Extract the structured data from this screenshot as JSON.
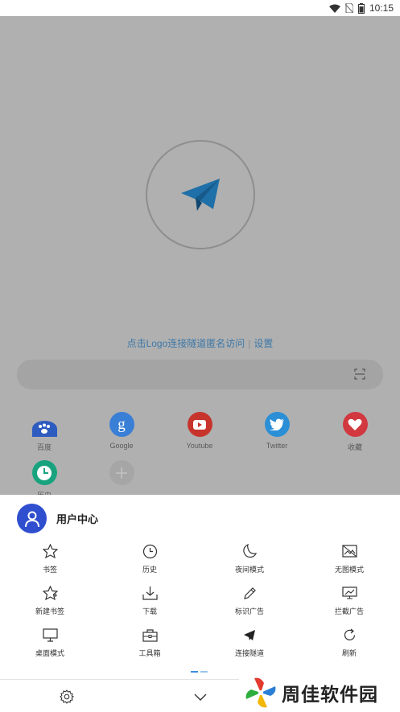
{
  "status_bar": {
    "time": "10:15"
  },
  "home": {
    "hint_text": "点击Logo连接隧道匿名访问",
    "hint_link": "设置",
    "quick_links": [
      {
        "label": "百度",
        "icon": "paw-icon",
        "color": "#2e5bbf"
      },
      {
        "label": "Google",
        "icon": "google-icon",
        "color": "#3a7fd6"
      },
      {
        "label": "Youtube",
        "icon": "youtube-icon",
        "color": "#c7342b"
      },
      {
        "label": "Twitter",
        "icon": "twitter-icon",
        "color": "#2b8fd6"
      },
      {
        "label": "收藏",
        "icon": "heart-icon",
        "color": "#d2383f"
      },
      {
        "label": "历史",
        "icon": "clock-icon",
        "color": "#18a37e"
      },
      {
        "label": "",
        "icon": "plus-icon",
        "color": "#a6a6a6"
      }
    ]
  },
  "sheet": {
    "user_center": "用户中心",
    "menu": [
      {
        "label": "书签",
        "icon": "star-icon"
      },
      {
        "label": "历史",
        "icon": "clock-icon"
      },
      {
        "label": "夜间模式",
        "icon": "moon-icon"
      },
      {
        "label": "无图模式",
        "icon": "no-image-icon"
      },
      {
        "label": "新建书签",
        "icon": "star-plus-icon"
      },
      {
        "label": "下载",
        "icon": "download-icon"
      },
      {
        "label": "标识广告",
        "icon": "pen-icon"
      },
      {
        "label": "拦截广告",
        "icon": "block-ad-icon"
      },
      {
        "label": "桌面模式",
        "icon": "desktop-icon"
      },
      {
        "label": "工具箱",
        "icon": "toolbox-icon"
      },
      {
        "label": "连接隧道",
        "icon": "send-icon"
      },
      {
        "label": "刷新",
        "icon": "refresh-icon"
      }
    ]
  },
  "watermark": {
    "text": "周佳软件园"
  },
  "colors": {
    "accent": "#2f4fcf",
    "link": "#3c78a8",
    "overlay": "#b0b0b0"
  }
}
